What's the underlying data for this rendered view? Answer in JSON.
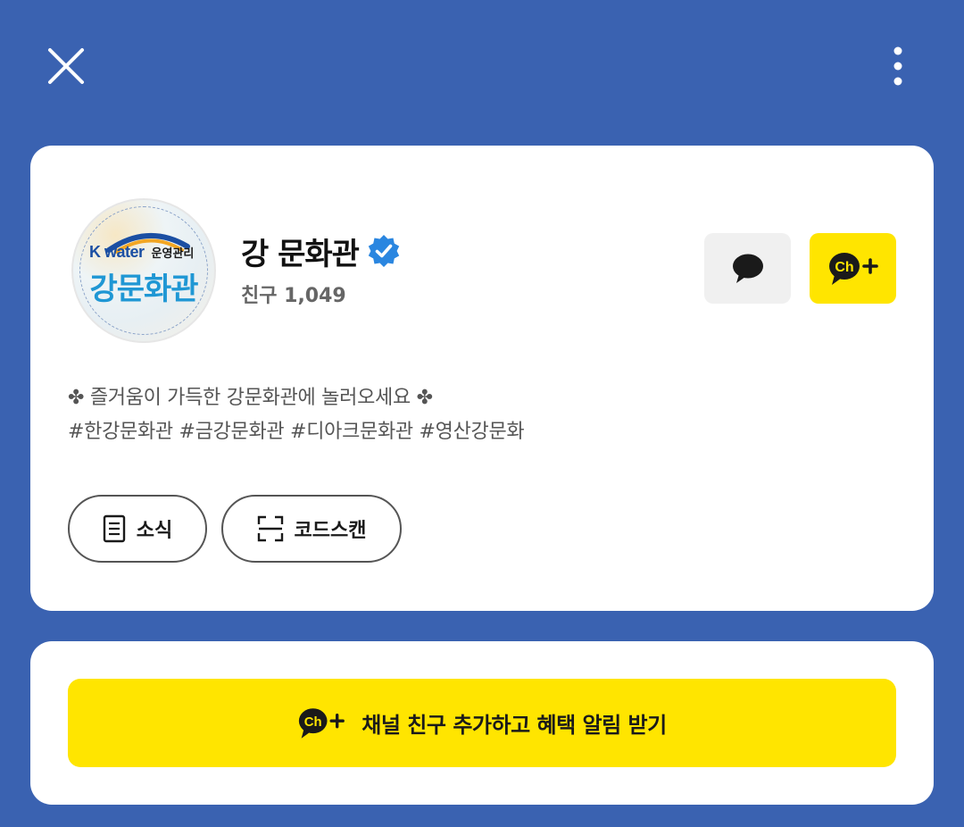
{
  "header": {
    "close_icon": "close-icon",
    "more_icon": "more-vertical-icon"
  },
  "profile": {
    "avatar": {
      "brand": "K water",
      "subtitle": "운영관리",
      "name": "강문화관"
    },
    "channel_name": "강 문화관",
    "verified_icon": "verified-badge-icon",
    "friends": "친구 1,049",
    "chat_icon": "chat-bubble-icon",
    "add_channel_icon": "channel-add-icon",
    "description": [
      "✤ 즐거움이 가득한 강문화관에 놀러오세요 ✤",
      "#한강문화관 #금강문화관 #디아크문화관 #영산강문화"
    ],
    "buttons": {
      "news_label": "소식",
      "code_scan_label": "코드스캔"
    }
  },
  "cta": {
    "label": "채널 친구 추가하고 혜택 알림 받기",
    "icon": "channel-add-icon"
  },
  "colors": {
    "background": "#3a62b1",
    "accent_yellow": "#ffe500",
    "verified_blue": "#2a86e0"
  }
}
